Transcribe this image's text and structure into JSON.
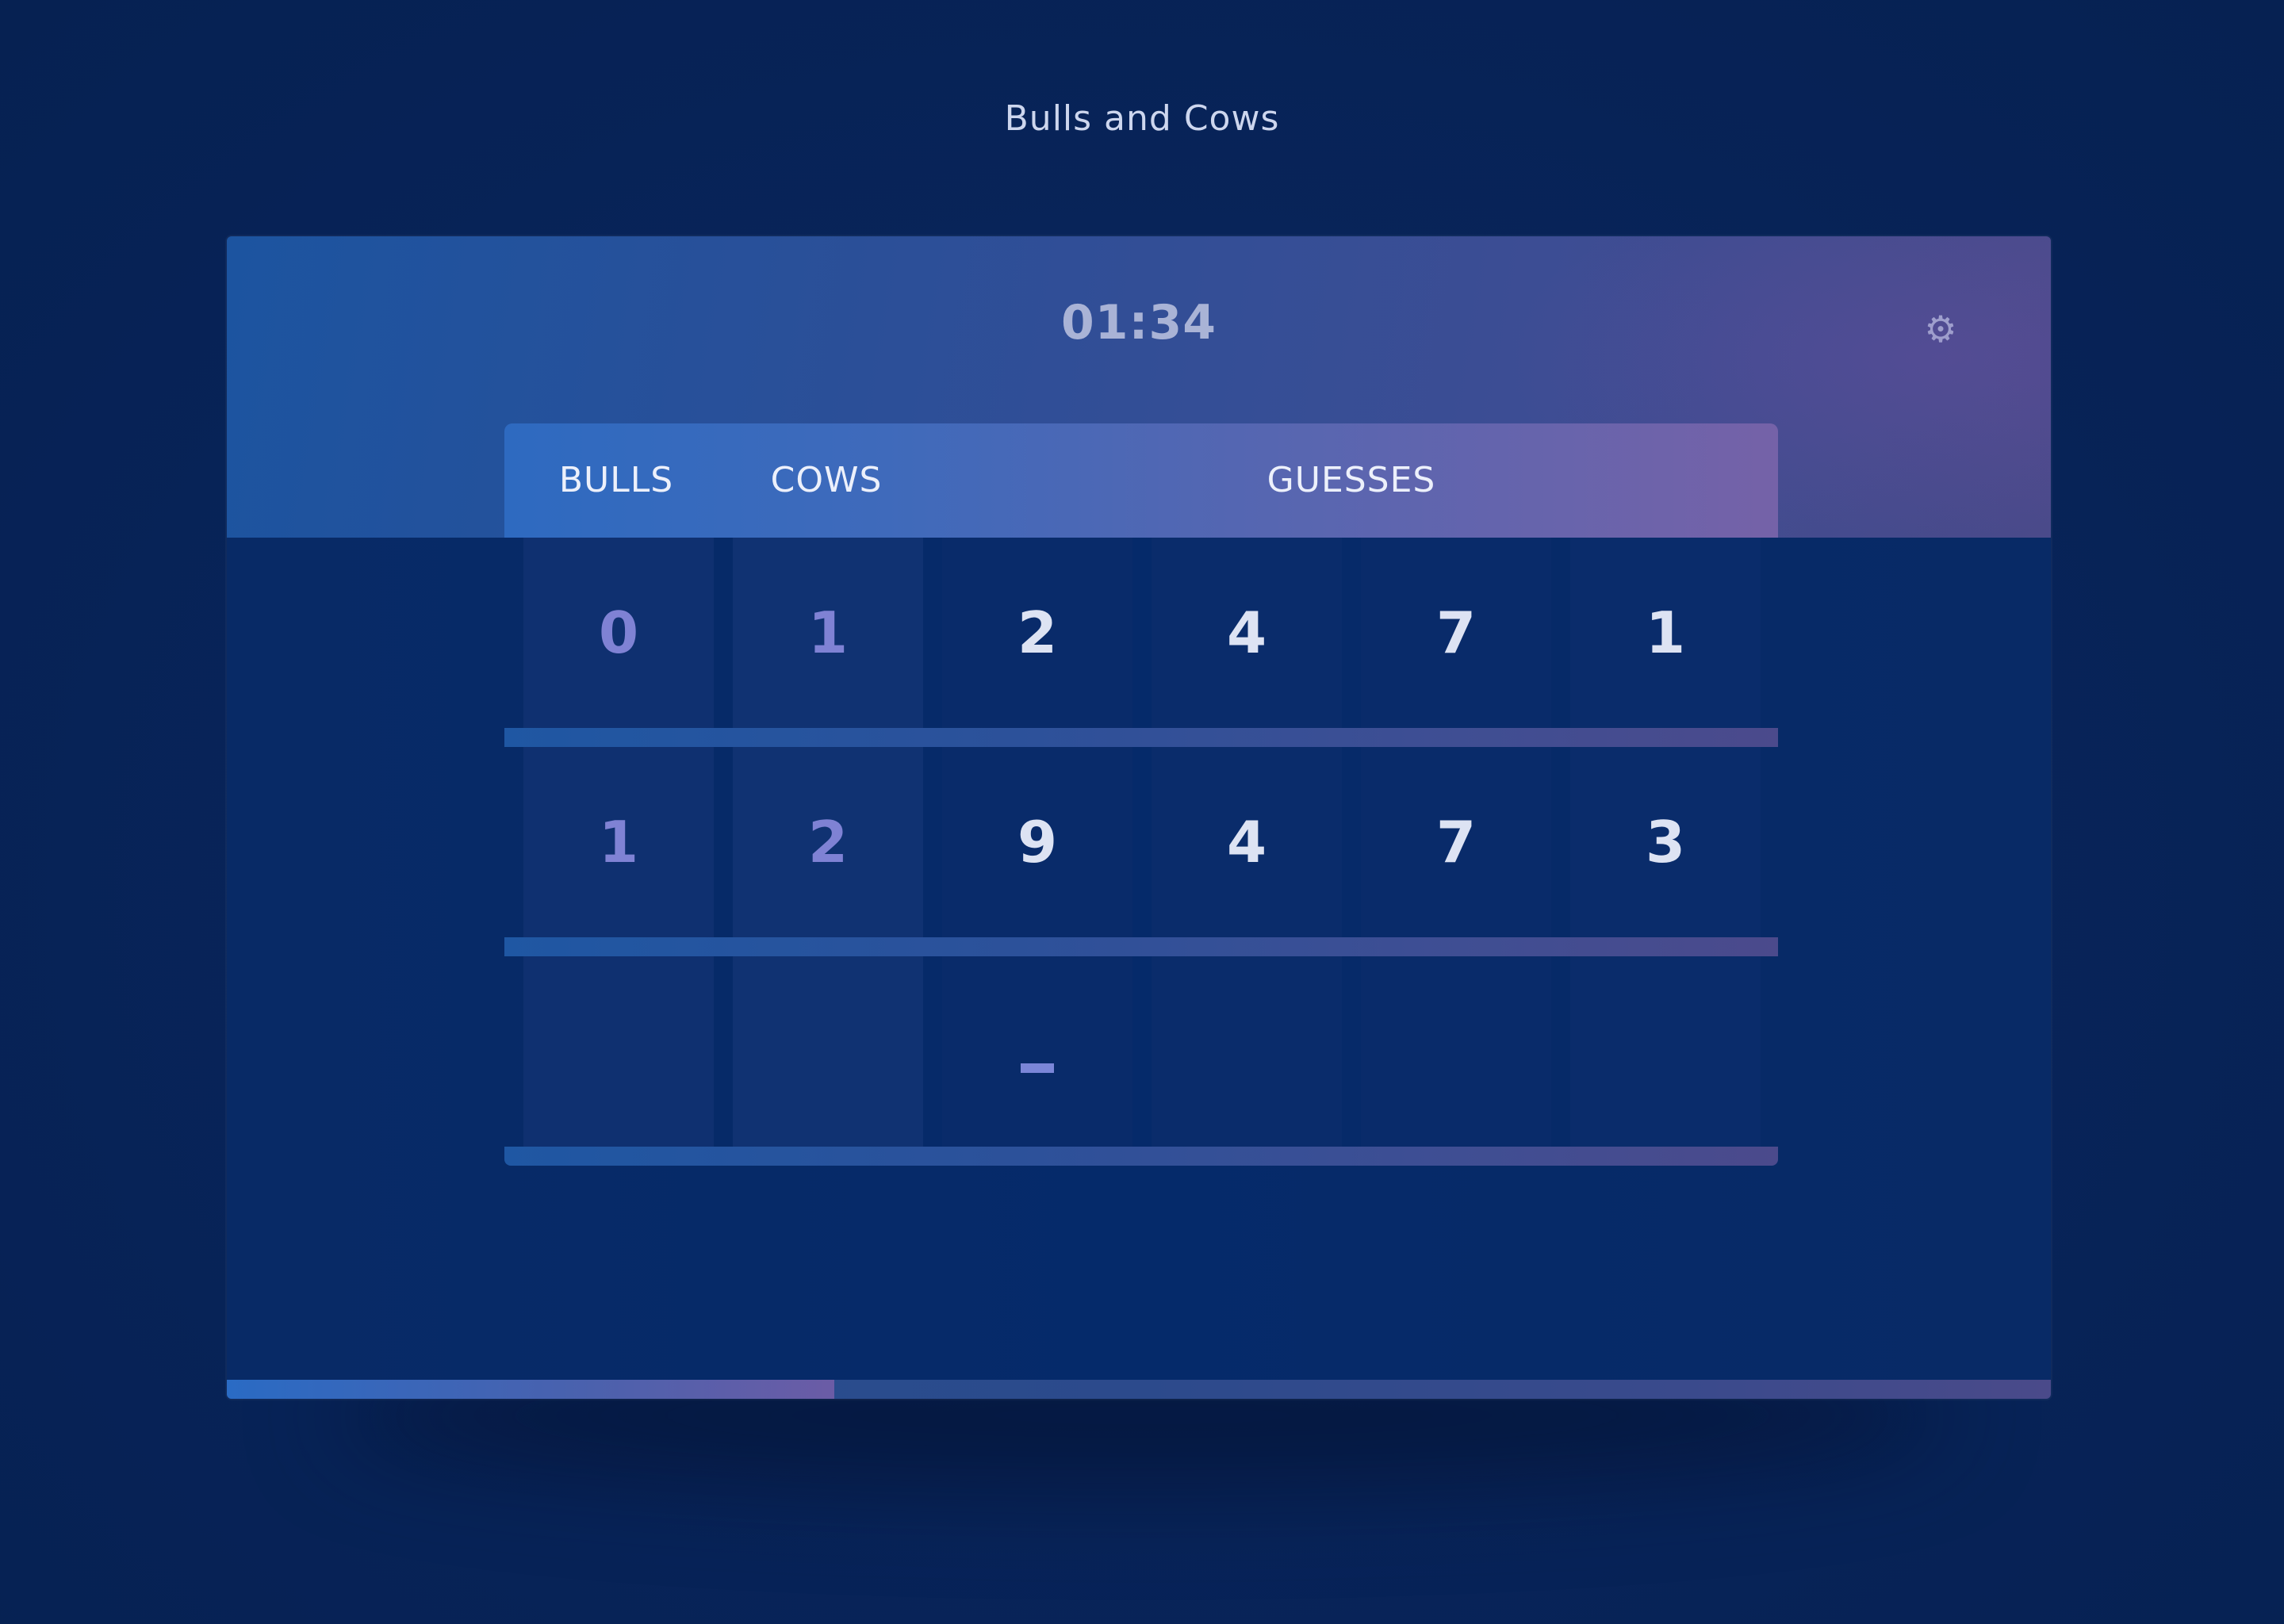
{
  "app": {
    "title": "Bulls and Cows"
  },
  "header": {
    "timer": "01:34",
    "settings_icon": "gear-icon"
  },
  "board": {
    "columns": {
      "bulls": "BULLS",
      "cows": "COWS",
      "guesses": "GUESSES"
    },
    "rows": [
      {
        "bulls": "0",
        "cows": "1",
        "guess": [
          "2",
          "4",
          "7",
          "1"
        ]
      },
      {
        "bulls": "1",
        "cows": "2",
        "guess": [
          "9",
          "4",
          "7",
          "3"
        ]
      },
      {
        "bulls": "",
        "cows": "",
        "guess": [
          "",
          "",
          "",
          ""
        ],
        "active": true
      }
    ]
  },
  "progress": {
    "fraction": 0.333
  },
  "colors": {
    "background": "#062152",
    "accent_blue": "#2e6ac0",
    "accent_purple": "#7562a8",
    "score_digit": "#7f82d4",
    "guess_digit": "#dde3f3"
  }
}
